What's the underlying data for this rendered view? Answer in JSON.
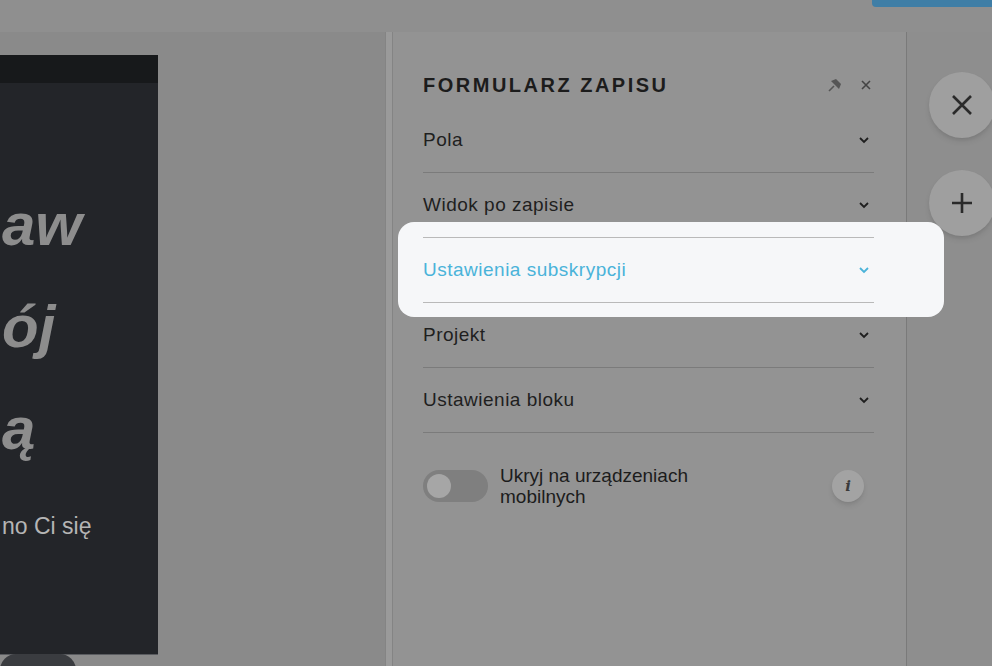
{
  "canvas": {
    "heading_lines": [
      "aw",
      "ój",
      "ą"
    ],
    "subtext": "no Ci się"
  },
  "panel": {
    "title": "FORMULARZ ZAPISU",
    "sections": [
      {
        "label": "Pola",
        "selected": false
      },
      {
        "label": "Widok po zapisie",
        "selected": false
      },
      {
        "label": "Ustawienia subskrypcji",
        "selected": true
      },
      {
        "label": "Projekt",
        "selected": false
      },
      {
        "label": "Ustawienia bloku",
        "selected": false
      }
    ],
    "toggle": {
      "label": "Ukryj na urządzeniach mobilnych",
      "on": false
    },
    "info": "i"
  }
}
